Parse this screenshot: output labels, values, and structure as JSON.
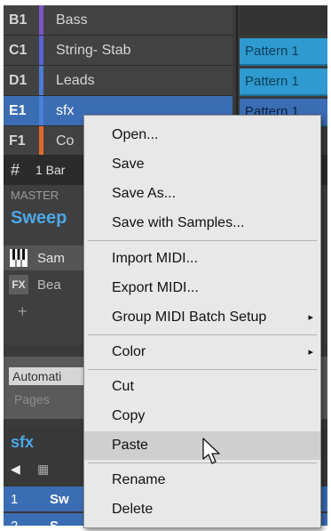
{
  "groups": [
    {
      "code": "B1",
      "name": "Bass",
      "color": "#7a56c9"
    },
    {
      "code": "C1",
      "name": "String- Stab",
      "color": "#5c61d6"
    },
    {
      "code": "D1",
      "name": "Leads",
      "color": "#4c7ad6"
    },
    {
      "code": "E1",
      "name": "sfx",
      "color": "#4a7fd6"
    },
    {
      "code": "F1",
      "name": "Co",
      "color": "#e06a2a"
    }
  ],
  "patterns": [
    "Pattern 1",
    "Pattern 1",
    "Pattern 1"
  ],
  "bar": {
    "length": "1 Bar"
  },
  "master": {
    "label": "MASTER",
    "sound": "Sweep",
    "slots": [
      {
        "icon": "keyboard-icon",
        "label": "Sam"
      },
      {
        "icon": "fx-icon",
        "label": "Bea",
        "fx_text": "FX"
      }
    ],
    "plus": "+"
  },
  "automation": {
    "button": "Automati",
    "pages": "Pages"
  },
  "sfx": {
    "name": "sfx",
    "rows": [
      {
        "num": "1",
        "text": "Sw"
      },
      {
        "num": "2",
        "text": "S"
      }
    ]
  },
  "menu": {
    "items": [
      {
        "label": "Open..."
      },
      {
        "label": "Save"
      },
      {
        "label": "Save As..."
      },
      {
        "label": "Save with Samples..."
      },
      {
        "label": "Import MIDI..."
      },
      {
        "label": "Export MIDI..."
      },
      {
        "label": "Group MIDI Batch Setup",
        "submenu": "▸"
      },
      {
        "label": "Color",
        "submenu": "▸"
      },
      {
        "label": "Cut"
      },
      {
        "label": "Copy"
      },
      {
        "label": "Paste"
      },
      {
        "label": "Rename"
      },
      {
        "label": "Delete"
      }
    ],
    "hovered": "Paste"
  }
}
